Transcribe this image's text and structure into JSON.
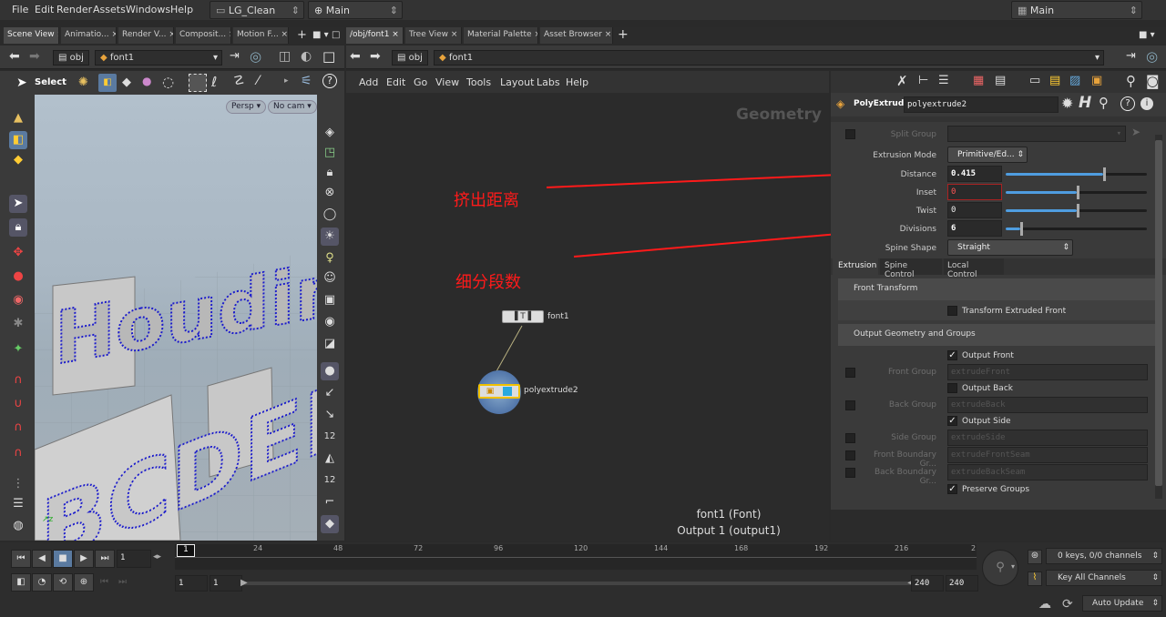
{
  "menubar": {
    "items": [
      "File",
      "Edit",
      "Render",
      "Assets",
      "Windows",
      "Help"
    ],
    "scene_dropdown": "LG_Clean",
    "desktop_dropdown": "Main",
    "right_dropdown": "Main"
  },
  "left_tabs": [
    "Scene View",
    "Animatio...",
    "Render V...",
    "Composit...",
    "Motion F..."
  ],
  "right_tabs": [
    "/obj/font1",
    "Tree View",
    "Material Palette",
    "Asset Browser"
  ],
  "left_path": {
    "obj": "obj",
    "node": "font1"
  },
  "right_path": {
    "obj": "obj",
    "node": "font1"
  },
  "viewport": {
    "tool_label": "Select",
    "persp": "Persp",
    "camera": "No cam",
    "text_top": "Houdini",
    "text_bottom": "BCDEFG"
  },
  "network": {
    "menu": [
      "Add",
      "Edit",
      "Go",
      "View",
      "Tools",
      "Layout",
      "Labs",
      "Help"
    ],
    "context_label": "Geometry",
    "annotation_distance": "挤出距离",
    "annotation_divisions": "细分段数",
    "node_font": "font1",
    "node_extrude": "polyextrude2",
    "info_line1": "font1 (Font)",
    "info_line2": "Output 1 (output1)"
  },
  "parms": {
    "node_type": "PolyExtrude",
    "node_name": "polyextrude2",
    "split_group_label": "Split Group",
    "extrusion_mode_label": "Extrusion Mode",
    "extrusion_mode_value": "Primitive/Ed...",
    "distance_label": "Distance",
    "distance_value": "0.415",
    "distance_fraction": 0.69,
    "inset_label": "Inset",
    "inset_value": "0",
    "twist_label": "Twist",
    "twist_value": "0",
    "divisions_label": "Divisions",
    "divisions_value": "6",
    "divisions_fraction": 0.1,
    "spine_shape_label": "Spine Shape",
    "spine_shape_value": "Straight",
    "tabs": [
      "Extrusion",
      "Spine Control",
      "Local Control"
    ],
    "front_transform": "Front Transform",
    "transform_extruded_front": "Transform Extruded Front",
    "output_section": "Output Geometry and Groups",
    "output_front": "Output Front",
    "front_group_label": "Front Group",
    "front_group_value": "extrudeFront",
    "output_back": "Output Back",
    "back_group_label": "Back Group",
    "back_group_value": "extrudeBack",
    "output_side": "Output Side",
    "side_group_label": "Side Group",
    "side_group_value": "extrudeSide",
    "front_boundary_label": "Front Boundary Gr...",
    "front_boundary_value": "extrudeFrontSeam",
    "back_boundary_label": "Back Boundary Gr...",
    "back_boundary_value": "extrudeBackSeam",
    "preserve_groups": "Preserve Groups"
  },
  "timeline": {
    "current_frame": "1",
    "ticks": [
      "24",
      "48",
      "72",
      "96",
      "120",
      "144",
      "168",
      "192",
      "216",
      "2"
    ],
    "range_start": "1",
    "range_start2": "1",
    "range_end": "240",
    "range_end2": "240",
    "keys_info": "0 keys, 0/0 channels",
    "key_all": "Key All Channels",
    "auto_update": "Auto Update",
    "frame_marker": "1"
  },
  "colors": {
    "accent": "#4f9de0",
    "annotation": "#ff1a1a",
    "node_select": "#f0c000"
  }
}
